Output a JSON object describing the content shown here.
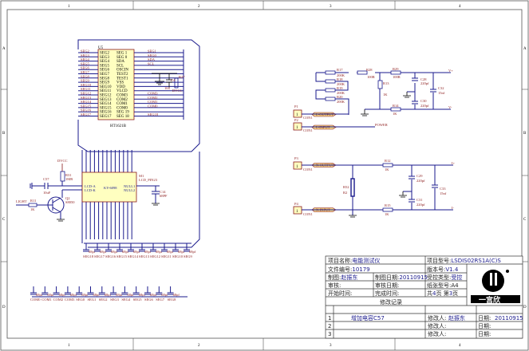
{
  "frame": {
    "cols": [
      "1",
      "2",
      "3",
      "4"
    ],
    "rows": [
      "A",
      "B",
      "C",
      "D"
    ]
  },
  "u5": {
    "ref": "U5",
    "part": "HT1621B",
    "left_pins": [
      "SEG2",
      "SEG3",
      "SEG4",
      "SEG5",
      "SEG6",
      "SEG7",
      "SEG8",
      "SEG9",
      "SEG10",
      "SEG11",
      "SEG12",
      "SEG13",
      "SEG14",
      "SEG15",
      "SEG16",
      "SEG17"
    ],
    "left_nets": [
      "SEG2",
      "SEG3",
      "SEG4",
      "SEG5",
      "SEG6",
      "SEG7",
      "SEG8",
      "SEG9",
      "SEG10",
      "SEG11",
      "SEG12",
      "SEG13",
      "SEG14",
      "SEG15",
      "SEG16",
      "SEG17"
    ],
    "right_pins": [
      "SEG 1",
      "SEG 0",
      "SDA",
      "SCL",
      "OSCIN",
      "TEST2",
      "TEST1",
      "VSS",
      "VDD",
      "VLCD",
      "COM3",
      "COM2",
      "COM1",
      "COM0",
      "SEG 19",
      "SEG 18"
    ],
    "right_nets": [
      "SEG1",
      "SEG0",
      "SDA",
      "SCL",
      "",
      "",
      "",
      "",
      "",
      "",
      "COM3",
      "COM2",
      "COM1",
      "COM0",
      "",
      "SEG18"
    ],
    "c4": "C4",
    "c4v": "104",
    "r27": "R27",
    "dvcc": "DVCC"
  },
  "lcd": {
    "ref": "M1",
    "part": "KY-6098",
    "label": "LCD_PIN23",
    "pin_a": "LCD-A",
    "pin_k": "LCD-K",
    "null1": "NULL1",
    "null2": "NULL2",
    "c14": "C14",
    "c14v": "68PF"
  },
  "backlight": {
    "dvcc": "DVCC",
    "r31": "R31",
    "r31v": "1MR",
    "c57": "C57",
    "c57v": "10uF",
    "q2": "Q2",
    "q2v": "S8050",
    "r11": "R11",
    "r11v": "1K",
    "light": "LIGHT"
  },
  "caps": {
    "row1": [
      "SEG18",
      "SEG17",
      "SEG16",
      "SEG15",
      "SEG14",
      "SEG13",
      "SEG12",
      "SEG11",
      "SEG10",
      "SEG9"
    ],
    "row2": [
      "COM0",
      "COM1",
      "COM2",
      "COM3",
      "SEG0",
      "SEG1",
      "SEG2",
      "SEG3",
      "SEG4",
      "SEG5",
      "SEG6",
      "SEG7",
      "SEG8"
    ],
    "val": "68pf"
  },
  "lpath": {
    "r17": "R17",
    "r18": "R18",
    "r19": "R19",
    "r20": "R20",
    "rv": "200K",
    "r28": "R28",
    "r29": "R29",
    "r100": "100R",
    "r13": "R13",
    "r14": "R14",
    "r1k": "1K",
    "c28": "C28",
    "c30": "C30",
    "c220": "220pf",
    "c32": "C32",
    "c15": "15nf",
    "vp": "V+",
    "vm": "V-",
    "p1": "P1",
    "p2": "P2",
    "pin": "1",
    "con": "CON1",
    "out": "L-OUTPUT",
    "inp": "L-INPUT",
    "power": "POWER"
  },
  "npath": {
    "p3": "P3",
    "p4": "P4",
    "pin": "1",
    "con": "CON1",
    "out": "N-OUTPUT",
    "inp": "N-INPUT",
    "r12": "R12",
    "r15": "R15",
    "r1k": "1K",
    "r52": "R52",
    "r52v": "R2",
    "c29": "C29",
    "c31": "C31",
    "c220": "220pf",
    "c33": "C33",
    "c15": "15nf",
    "ip": "I+",
    "im": "I-"
  },
  "title_block": {
    "project_name_label": "项目名称:",
    "project_name": "电能测试仪",
    "project_model_label": "项目型号:",
    "project_model": "LSDIS02RS1A(C)S",
    "file_no_label": "文件编号:",
    "file_no": "10179",
    "version_label": "版本号:",
    "version": "V1.4",
    "drawn_label": "制图:",
    "drawn_by": "赵振东",
    "drawn_date_label": "制图日期:",
    "drawn_date": "20110915",
    "control_label": "受控类型:",
    "control": "受控",
    "review_label": "审核:",
    "review_date_label": "审核日期:",
    "paper_label": "纸张型号:",
    "paper": "A4",
    "start_label": "开始时间:",
    "finish_label": "完成时间:",
    "pages_pre": "共",
    "pages_total": "4",
    "pages_mid": "页 第",
    "page_no": "3",
    "pages_post": "页",
    "rev_header": "修改记录",
    "logo_text": "一宫欣",
    "revisions": [
      {
        "no": "1",
        "desc": "增加电容C57",
        "by_label": "修改人:",
        "by": "赵振东",
        "date_label": "日期:",
        "date": "20110915"
      },
      {
        "no": "2",
        "desc": "",
        "by_label": "修改人:",
        "by": "",
        "date_label": "日期:",
        "date": ""
      },
      {
        "no": "3",
        "desc": "",
        "by_label": "修改人:",
        "by": "",
        "date_label": "日期:",
        "date": ""
      }
    ]
  }
}
